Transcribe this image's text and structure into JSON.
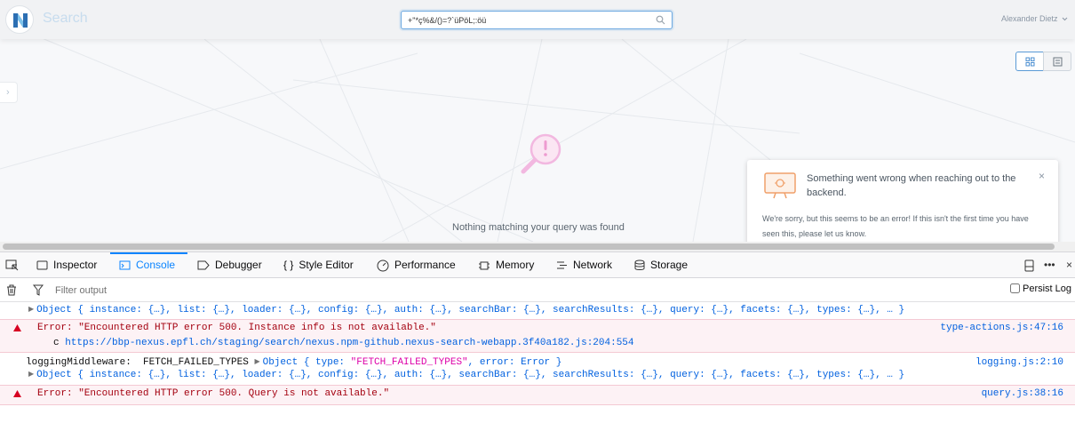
{
  "app": {
    "title": "Search",
    "search_value": "+\"*ç%&/()=?`üPöL;:öü",
    "user": "Alexander Dietz",
    "side_toggle": "›",
    "empty_message": "Nothing matching your query was found",
    "toast": {
      "title": "Something went wrong when reaching out to the backend.",
      "body": "We're sorry, but this seems to be an error! If this isn't the first time you have seen this, please let us know.",
      "close": "×"
    }
  },
  "devtools": {
    "tabs": [
      "Inspector",
      "Console",
      "Debugger",
      "Style Editor",
      "Performance",
      "Memory",
      "Network",
      "Storage"
    ],
    "active_tab": "Console",
    "filter_placeholder": "Filter output",
    "persist_label": "Persist Log",
    "more": "•••",
    "logs": {
      "obj1_prefix": "Object { instance: {…}, list: {…}, loader: {…}, config: {…}, auth: {…}, searchBar: {…}, searchResults: {…}, query: {…}, facets: {…}, types: {…}, … }",
      "err1_text": "Error: \"Encountered HTTP error 500. Instance info is not available.\"",
      "err1_loc": "type-actions.js:47:16",
      "err1_stack_fn": "c ",
      "err1_stack_url": "https://bbp-nexus.epfl.ch/staging/search/nexus.npm-github.nexus-search-webapp.3f40a182.js:204:554",
      "mw_label": "loggingMiddleware:  FETCH_FAILED_TYPES ",
      "mw_obj_a": "Object { type: ",
      "mw_obj_str": "\"FETCH_FAILED_TYPES\"",
      "mw_obj_b": ", error: Error }",
      "mw_loc": "logging.js:2:10",
      "obj2": "Object { instance: {…}, list: {…}, loader: {…}, config: {…}, auth: {…}, searchBar: {…}, searchResults: {…}, query: {…}, facets: {…}, types: {…}, … }",
      "err2_text": "Error: \"Encountered HTTP error 500. Query is not available.\"",
      "err2_loc": "query.js:38:16"
    }
  },
  "colors": {
    "accent": "#0a84ff",
    "error_text": "#a4000f",
    "link": "#0060df",
    "toast_icon": "#f0a06a"
  }
}
